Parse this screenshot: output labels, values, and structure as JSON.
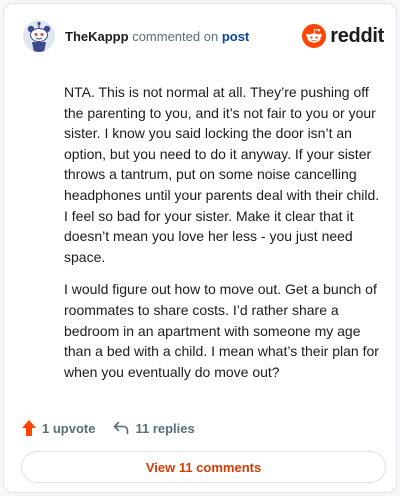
{
  "comment": {
    "username": "TheKappp",
    "action_text": "commented on",
    "post_link": "post",
    "brand": "reddit",
    "paragraphs": [
      "NTA. This is not normal at all. They’re pushing off the parenting to you, and it’s not fair to you or your sister. I know you said locking the door isn’t an option, but you need to do it anyway. If your sister throws a tantrum, put on some noise cancelling headphones until your parents deal with their child. I feel so bad for your sister. Make it clear that it doesn’t mean you love her less - you just need space.",
      "I would figure out how to move out. Get a bunch of roommates to share costs. I’d rather share a bedroom in an apartment with someone my age than a bed with a child. I mean what’s their plan for when you eventually do move out?"
    ],
    "upvotes": "1 upvote",
    "replies": "11 replies",
    "view_comments": "View 11 comments"
  },
  "icons": {
    "avatar": "snoo-avatar",
    "logo": "reddit-logo-icon",
    "upvote": "upvote-arrow-icon",
    "reply": "reply-arrow-icon"
  },
  "colors": {
    "brand_orange": "#ff4500",
    "link_blue": "#0a449b",
    "button_text": "#d93a00",
    "muted": "#576f76"
  }
}
